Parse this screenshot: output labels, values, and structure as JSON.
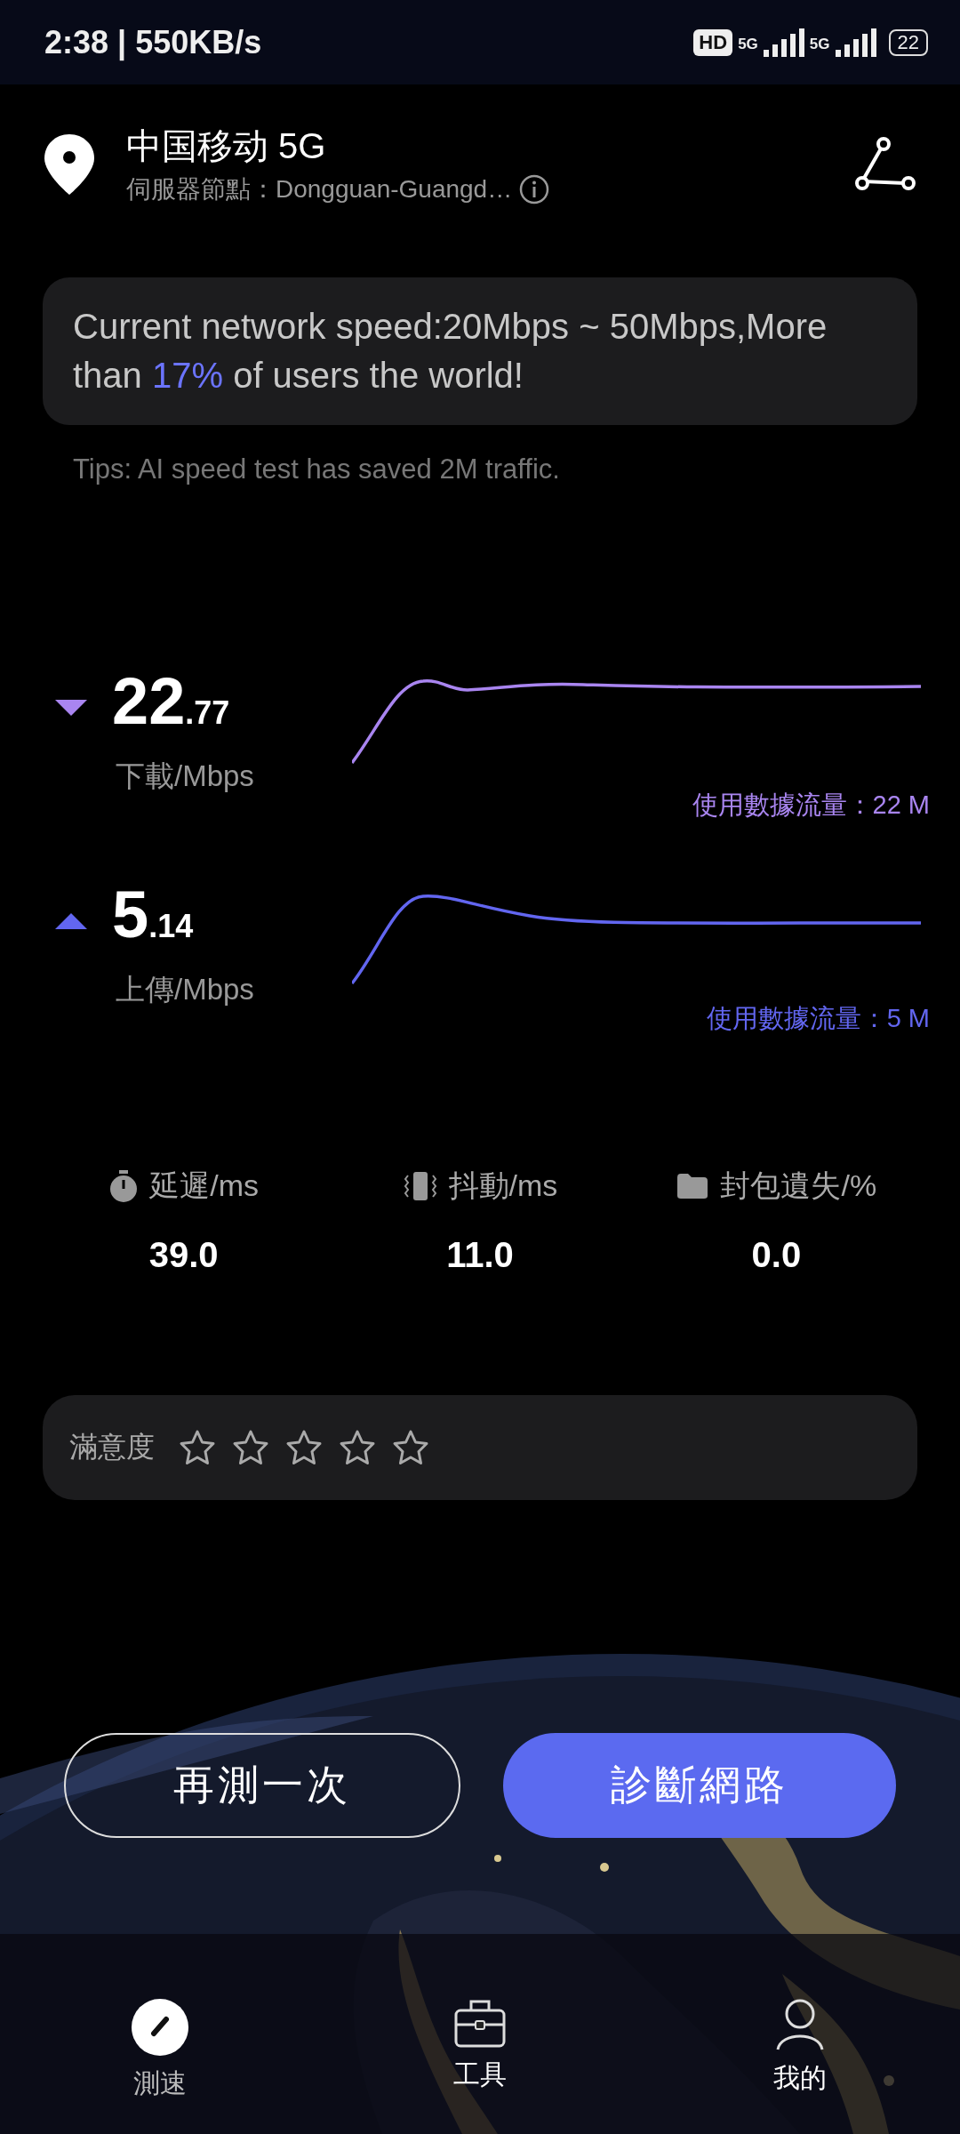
{
  "status_bar": {
    "time_speed": "2:38 | 550KB/s",
    "hd_badge": "HD",
    "sim1": "5G",
    "sim2": "5G",
    "battery": "22"
  },
  "header": {
    "carrier": "中国移动 5G",
    "server_label": "伺服器節點：",
    "server": "Dongguan-Guangd…"
  },
  "summary": {
    "before": "Current network speed:20Mbps ~ 50Mbps,More than ",
    "highlight": "17%",
    "after": " of users the world!"
  },
  "tips": "Tips: AI speed test has saved 2M traffic.",
  "speeds": [
    {
      "kind": "download",
      "int": "22",
      "frac": ".77",
      "unit": "下載/Mbps",
      "usage": "使用數據流量：22 M",
      "color": "#a985f0"
    },
    {
      "kind": "upload",
      "int": "5",
      "frac": ".14",
      "unit": "上傳/Mbps",
      "usage": "使用數據流量：5 M",
      "color": "#6266f0"
    }
  ],
  "metrics": [
    {
      "kind": "latency",
      "label": "延遲/ms",
      "value": "39.0"
    },
    {
      "kind": "jitter",
      "label": "抖動/ms",
      "value": "11.0"
    },
    {
      "kind": "loss",
      "label": "封包遺失/%",
      "value": "0.0"
    }
  ],
  "satisfaction": {
    "label": "滿意度",
    "stars": 0
  },
  "buttons": [
    {
      "label": "再測一次",
      "kind": "outline"
    },
    {
      "label": "診斷網路",
      "kind": "primary"
    }
  ],
  "nav": [
    {
      "label": "測速",
      "kind": "speed",
      "selected": true
    },
    {
      "label": "工具",
      "kind": "tools",
      "selected": false
    },
    {
      "label": "我的",
      "kind": "profile",
      "selected": false
    }
  ]
}
